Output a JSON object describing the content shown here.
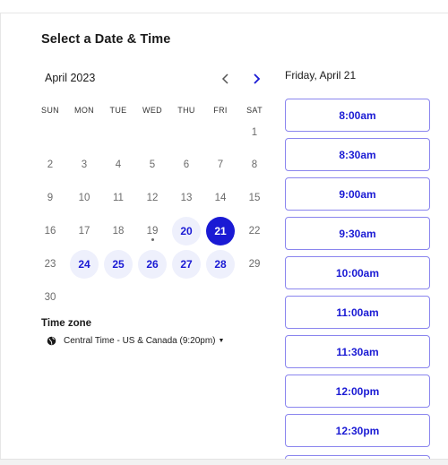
{
  "header": {
    "title": "Select a Date & Time"
  },
  "calendar": {
    "month_label": "April 2023",
    "weekdays": [
      "SUN",
      "MON",
      "TUE",
      "WED",
      "THU",
      "FRI",
      "SAT"
    ],
    "days": [
      {
        "n": "1",
        "state": "disabled"
      },
      {
        "n": "2",
        "state": "disabled"
      },
      {
        "n": "3",
        "state": "disabled"
      },
      {
        "n": "4",
        "state": "disabled"
      },
      {
        "n": "5",
        "state": "disabled"
      },
      {
        "n": "6",
        "state": "disabled"
      },
      {
        "n": "7",
        "state": "disabled"
      },
      {
        "n": "8",
        "state": "disabled"
      },
      {
        "n": "9",
        "state": "disabled"
      },
      {
        "n": "10",
        "state": "disabled"
      },
      {
        "n": "11",
        "state": "disabled"
      },
      {
        "n": "12",
        "state": "disabled"
      },
      {
        "n": "13",
        "state": "disabled"
      },
      {
        "n": "14",
        "state": "disabled"
      },
      {
        "n": "15",
        "state": "disabled"
      },
      {
        "n": "16",
        "state": "disabled"
      },
      {
        "n": "17",
        "state": "disabled"
      },
      {
        "n": "18",
        "state": "disabled"
      },
      {
        "n": "19",
        "state": "today"
      },
      {
        "n": "20",
        "state": "available"
      },
      {
        "n": "21",
        "state": "selected"
      },
      {
        "n": "22",
        "state": "disabled"
      },
      {
        "n": "23",
        "state": "disabled"
      },
      {
        "n": "24",
        "state": "available"
      },
      {
        "n": "25",
        "state": "available"
      },
      {
        "n": "26",
        "state": "available"
      },
      {
        "n": "27",
        "state": "available"
      },
      {
        "n": "28",
        "state": "available"
      },
      {
        "n": "29",
        "state": "disabled"
      },
      {
        "n": "30",
        "state": "disabled"
      }
    ],
    "first_weekday": 6
  },
  "timezone": {
    "label": "Time zone",
    "value": "Central Time - US & Canada (9:20pm)",
    "icon": "globe-icon"
  },
  "slots_panel": {
    "date_heading": "Friday, April 21",
    "slots": [
      "8:00am",
      "8:30am",
      "9:00am",
      "9:30am",
      "10:00am",
      "11:00am",
      "11:30am",
      "12:00pm",
      "12:30pm"
    ]
  },
  "colors": {
    "accent": "#1a1ad4",
    "available_bg": "#eef0fc",
    "slot_border": "#8a85ee",
    "disabled_text": "#6b6b6b"
  }
}
